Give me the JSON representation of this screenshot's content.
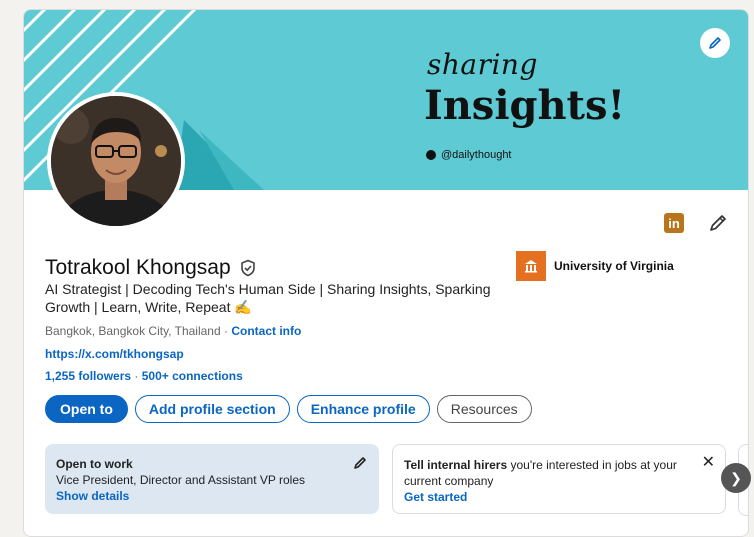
{
  "banner": {
    "title_line1": "sharing",
    "title_line2": "Insights!",
    "handle": "@dailythought",
    "edit_icon": "pencil-icon"
  },
  "profile": {
    "name": "Totrakool Khongsap",
    "verified_icon": "shield-check-icon",
    "headline": "AI Strategist | Decoding Tech's Human Side | Sharing Insights, Sparking Growth | Learn, Write, Repeat ✍️",
    "location": "Bangkok, Bangkok City, Thailand",
    "location_sep": " · ",
    "contact_info": "Contact info",
    "url": "https://x.com/tkhongsap",
    "followers": "1,255 followers",
    "connections_sep": " · ",
    "connections": "500+ connections"
  },
  "education": {
    "label": "University of Virginia"
  },
  "actions": {
    "open_to": "Open to",
    "add_section": "Add profile section",
    "enhance": "Enhance profile",
    "resources": "Resources"
  },
  "open_to_work": {
    "title": "Open to work",
    "roles": "Vice President, Director and Assistant VP roles",
    "link": "Show details"
  },
  "hirers": {
    "bold": "Tell internal hirers",
    "rest": " you're interested in jobs at your current company",
    "link": "Get started"
  },
  "colors": {
    "accent": "#0a66c2",
    "banner": "#5ecbd4"
  }
}
